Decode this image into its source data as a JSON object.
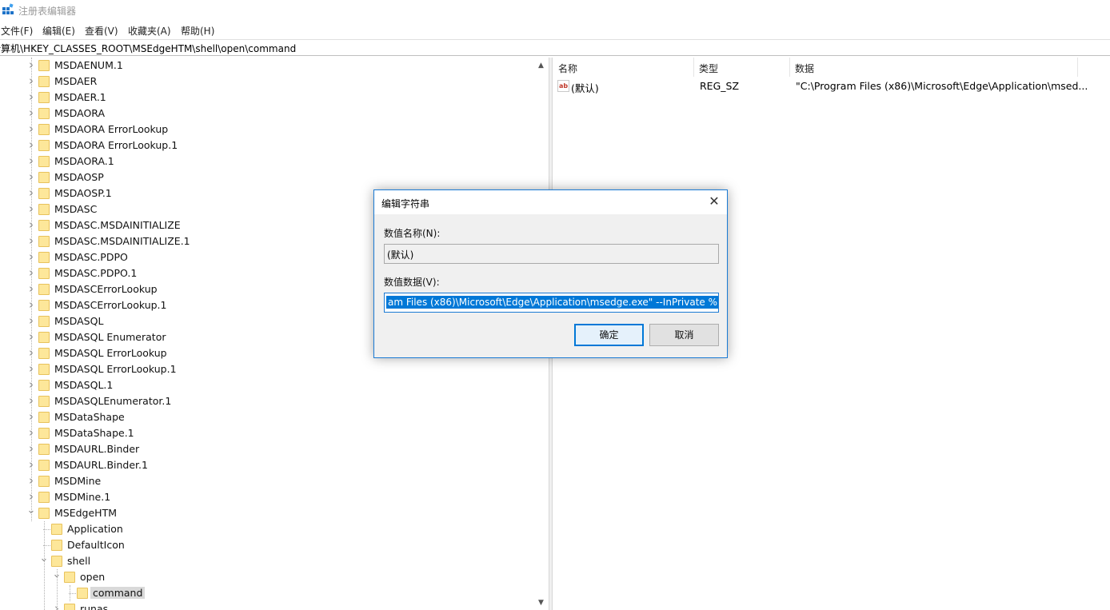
{
  "window": {
    "title": "注册表编辑器",
    "app_icon": "regedit-icon"
  },
  "menu": [
    "文件(F)",
    "编辑(E)",
    "查看(V)",
    "收藏夹(A)",
    "帮助(H)"
  ],
  "address": "计算机\\HKEY_CLASSES_ROOT\\MSEdgeHTM\\shell\\open\\command",
  "tree": {
    "items": [
      {
        "label": "MSDAENUM.1",
        "level": 0,
        "state": "collapsed"
      },
      {
        "label": "MSDAER",
        "level": 0,
        "state": "collapsed"
      },
      {
        "label": "MSDAER.1",
        "level": 0,
        "state": "collapsed"
      },
      {
        "label": "MSDAORA",
        "level": 0,
        "state": "collapsed"
      },
      {
        "label": "MSDAORA ErrorLookup",
        "level": 0,
        "state": "collapsed"
      },
      {
        "label": "MSDAORA ErrorLookup.1",
        "level": 0,
        "state": "collapsed"
      },
      {
        "label": "MSDAORA.1",
        "level": 0,
        "state": "collapsed"
      },
      {
        "label": "MSDAOSP",
        "level": 0,
        "state": "collapsed"
      },
      {
        "label": "MSDAOSP.1",
        "level": 0,
        "state": "collapsed"
      },
      {
        "label": "MSDASC",
        "level": 0,
        "state": "collapsed"
      },
      {
        "label": "MSDASC.MSDAINITIALIZE",
        "level": 0,
        "state": "collapsed"
      },
      {
        "label": "MSDASC.MSDAINITIALIZE.1",
        "level": 0,
        "state": "collapsed"
      },
      {
        "label": "MSDASC.PDPO",
        "level": 0,
        "state": "collapsed"
      },
      {
        "label": "MSDASC.PDPO.1",
        "level": 0,
        "state": "collapsed"
      },
      {
        "label": "MSDASCErrorLookup",
        "level": 0,
        "state": "collapsed"
      },
      {
        "label": "MSDASCErrorLookup.1",
        "level": 0,
        "state": "collapsed"
      },
      {
        "label": "MSDASQL",
        "level": 0,
        "state": "collapsed"
      },
      {
        "label": "MSDASQL Enumerator",
        "level": 0,
        "state": "collapsed"
      },
      {
        "label": "MSDASQL ErrorLookup",
        "level": 0,
        "state": "collapsed"
      },
      {
        "label": "MSDASQL ErrorLookup.1",
        "level": 0,
        "state": "collapsed"
      },
      {
        "label": "MSDASQL.1",
        "level": 0,
        "state": "collapsed"
      },
      {
        "label": "MSDASQLEnumerator.1",
        "level": 0,
        "state": "collapsed"
      },
      {
        "label": "MSDataShape",
        "level": 0,
        "state": "collapsed"
      },
      {
        "label": "MSDataShape.1",
        "level": 0,
        "state": "collapsed"
      },
      {
        "label": "MSDAURL.Binder",
        "level": 0,
        "state": "collapsed"
      },
      {
        "label": "MSDAURL.Binder.1",
        "level": 0,
        "state": "collapsed"
      },
      {
        "label": "MSDMine",
        "level": 0,
        "state": "collapsed"
      },
      {
        "label": "MSDMine.1",
        "level": 0,
        "state": "collapsed"
      },
      {
        "label": "MSEdgeHTM",
        "level": 0,
        "state": "expanded"
      },
      {
        "label": "Application",
        "level": 1,
        "state": "leaf"
      },
      {
        "label": "DefaultIcon",
        "level": 1,
        "state": "leaf"
      },
      {
        "label": "shell",
        "level": 1,
        "state": "expanded"
      },
      {
        "label": "open",
        "level": 2,
        "state": "expanded"
      },
      {
        "label": "command",
        "level": 3,
        "state": "leaf",
        "selected": true
      },
      {
        "label": "runas",
        "level": 2,
        "state": "collapsed"
      }
    ]
  },
  "values_pane": {
    "headers": [
      "名称",
      "类型",
      "数据"
    ],
    "rows": [
      {
        "name": "(默认)",
        "type": "REG_SZ",
        "data": "\"C:\\Program Files (x86)\\Microsoft\\Edge\\Application\\msed...",
        "icon": "string-value-icon"
      }
    ]
  },
  "dialog": {
    "title": "编辑字符串",
    "name_label": "数值名称(N):",
    "name_value": "(默认)",
    "data_label": "数值数据(V):",
    "data_value": "am Files (x86)\\Microsoft\\Edge\\Application\\msedge.exe\" --InPrivate %1",
    "ok": "确定",
    "cancel": "取消"
  },
  "colors": {
    "accent": "#0078d7",
    "folder": "#fde79a",
    "selection": "#d9d9d9"
  }
}
